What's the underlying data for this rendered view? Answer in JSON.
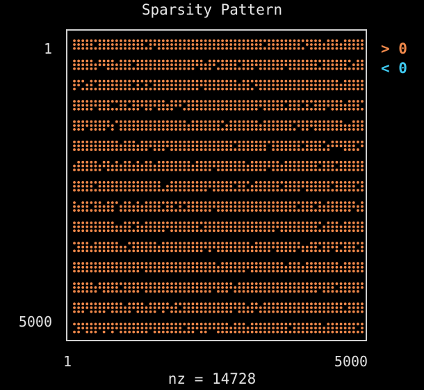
{
  "chart_data": {
    "type": "scatter",
    "title": "Sparsity Pattern",
    "xlabel": "nz = 14728",
    "x_ticks": [
      "1",
      "5000"
    ],
    "y_ticks": [
      "1",
      "5000"
    ],
    "xlim": [
      1,
      5000
    ],
    "ylim": [
      1,
      5000
    ],
    "y_inverted": true,
    "legend": [
      {
        "label": "> 0",
        "color": "#f0884a"
      },
      {
        "label": "< 0",
        "color": "#3fc9f0"
      }
    ],
    "legend_position": "top-right",
    "nnz": 14728,
    "pattern": {
      "row_blocks": 15,
      "rows_per_block": 3,
      "cols": 69,
      "description_values": "positive entries only"
    },
    "colors": {
      "positive": "#f0884a",
      "negative": "#3fc9f0",
      "frame": "#cfcfcf",
      "background": "#000000"
    }
  }
}
